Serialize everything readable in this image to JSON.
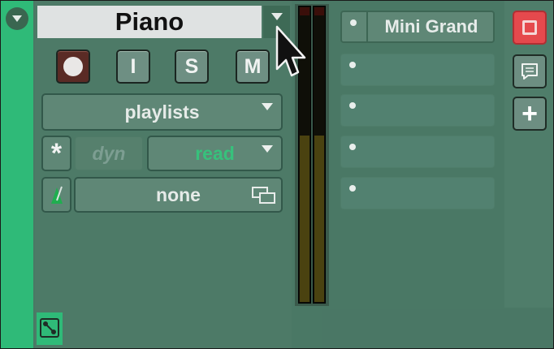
{
  "track": {
    "name": "Piano",
    "buttons": {
      "input": "I",
      "solo": "S",
      "mute": "M"
    },
    "playlists_label": "playlists",
    "automation": {
      "asterisk": "*",
      "dyn_label": "dyn",
      "mode": "read",
      "mode_color": "#37c17c"
    },
    "group_label": "none"
  },
  "inserts": [
    {
      "name": "Mini Grand"
    },
    {
      "name": ""
    },
    {
      "name": ""
    },
    {
      "name": ""
    },
    {
      "name": ""
    }
  ],
  "colors": {
    "track_color": "#2fba78",
    "record_arm": "#5a2b25",
    "power_active": "#e5494d"
  },
  "icons": {
    "collapse": "chevron-down-icon",
    "record": "record-icon",
    "metronome": "metronome-icon",
    "multi_window": "multi-window-icon",
    "power": "power-icon",
    "comments": "comments-icon",
    "add": "plus-icon",
    "routing": "routing-icon"
  }
}
